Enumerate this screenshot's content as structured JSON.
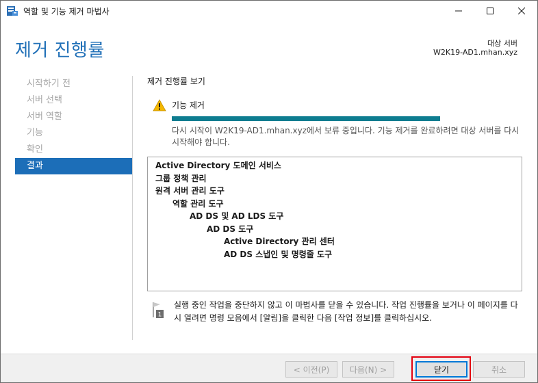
{
  "window": {
    "title": "역할 및 기능 제거 마법사",
    "controls": [
      "minimize-icon",
      "maximize-icon",
      "close-icon"
    ]
  },
  "header": {
    "page_title": "제거 진행률",
    "target_label": "대상 서버",
    "target_server": "W2K19-AD1.mhan.xyz"
  },
  "nav": {
    "items": [
      {
        "label": "시작하기 전",
        "state": "disabled"
      },
      {
        "label": "서버 선택",
        "state": "disabled"
      },
      {
        "label": "서버 역할",
        "state": "disabled"
      },
      {
        "label": "기능",
        "state": "disabled"
      },
      {
        "label": "확인",
        "state": "disabled"
      },
      {
        "label": "결과",
        "state": "active"
      }
    ]
  },
  "main": {
    "section_title": "제거 진행률 보기",
    "feature_title": "기능 제거",
    "status_icon": "warning-icon",
    "progress": 1.0,
    "status_message": "다시 시작이 W2K19-AD1.mhan.xyz에서 보류 중입니다. 기능 제거를 완료하려면 대상 서버를 다시 시작해야 합니다.",
    "results": [
      {
        "text": "Active Directory 도메인 서비스",
        "level": 0
      },
      {
        "text": "그룹 정책 관리",
        "level": 0
      },
      {
        "text": "원격 서버 관리 도구",
        "level": 0
      },
      {
        "text": "역할 관리 도구",
        "level": 1
      },
      {
        "text": "AD DS 및 AD LDS 도구",
        "level": 2
      },
      {
        "text": "AD DS 도구",
        "level": 3
      },
      {
        "text": "Active Directory 관리 센터",
        "level": 4
      },
      {
        "text": "AD DS 스냅인 및 명령줄 도구",
        "level": 4
      }
    ],
    "note_icon": "notification-flag-icon",
    "note_badge": "1",
    "note_text": "실행 중인 작업을 중단하지 않고 이 마법사를 닫을 수 있습니다. 작업 진행률을 보거나 이 페이지를 다시 열려면 명령 모음에서 [알림]을 클릭한 다음 [작업 정보]를 클릭하십시오."
  },
  "footer": {
    "prev_label": "< 이전(P)",
    "next_label": "다음(N) >",
    "close_label": "닫기",
    "cancel_label": "취소"
  },
  "colors": {
    "accent": "#2271b8",
    "nav_active": "#1c6eb8",
    "progress": "#0e7d90",
    "highlight": "#e3000f"
  }
}
